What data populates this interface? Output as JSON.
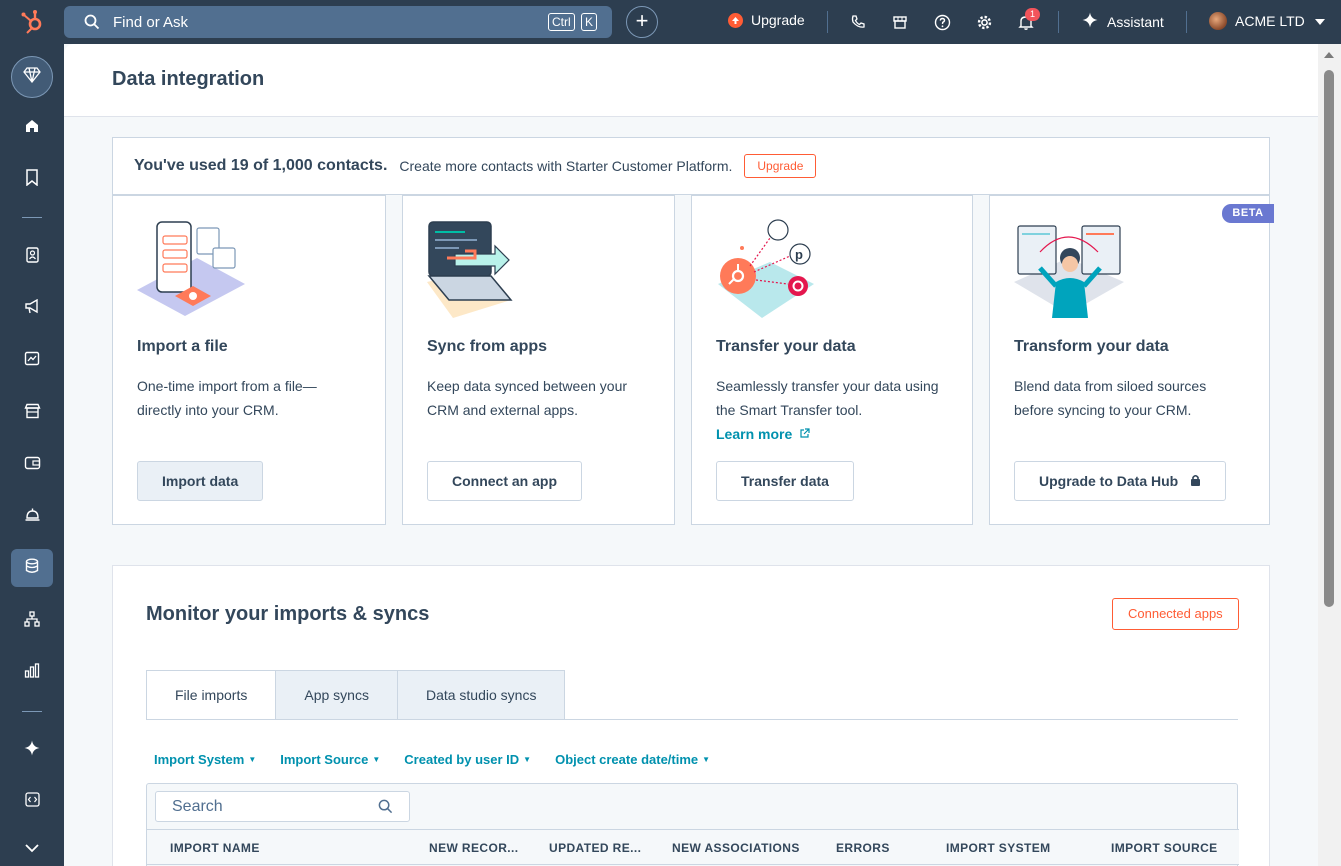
{
  "topbar": {
    "search_placeholder": "Find or Ask",
    "kbd_ctrl": "Ctrl",
    "kbd_k": "K",
    "plus": "+",
    "upgrade_label": "Upgrade",
    "notification_count": "1",
    "assistant_label": "Assistant",
    "account_label": "ACME LTD"
  },
  "page": {
    "title": "Data integration"
  },
  "banner": {
    "usage_text": "You've used 19 of 1,000 contacts.",
    "promo_text": "Create more contacts with Starter Customer Platform.",
    "upgrade_button": "Upgrade"
  },
  "cards": [
    {
      "title": "Import a file",
      "description": "One-time import from a file—directly into your CRM.",
      "button": "Import data"
    },
    {
      "title": "Sync from apps",
      "description": "Keep data synced between your CRM and external apps.",
      "button": "Connect an app"
    },
    {
      "title": "Transfer your data",
      "description": "Seamlessly transfer your data using the Smart Transfer tool.",
      "link": "Learn more",
      "button": "Transfer data"
    },
    {
      "title": "Transform your data",
      "description": "Blend data from siloed sources before syncing to your CRM.",
      "button": "Upgrade to Data Hub",
      "badge": "BETA"
    }
  ],
  "monitor": {
    "title": "Monitor your imports & syncs",
    "connected_apps_button": "Connected apps",
    "tabs": [
      "File imports",
      "App syncs",
      "Data studio syncs"
    ],
    "filters": [
      "Import System",
      "Import Source",
      "Created by user ID",
      "Object create date/time"
    ],
    "search_placeholder": "Search",
    "columns": [
      "IMPORT NAME",
      "NEW RECOR...",
      "UPDATED RE...",
      "NEW ASSOCIATIONS",
      "ERRORS",
      "IMPORT SYSTEM",
      "IMPORT SOURCE"
    ]
  },
  "colors": {
    "nav_bg": "#2d3e50",
    "accent_orange": "#ff5c35",
    "link_teal": "#0091ae",
    "beta_purple": "#6a78d1"
  }
}
